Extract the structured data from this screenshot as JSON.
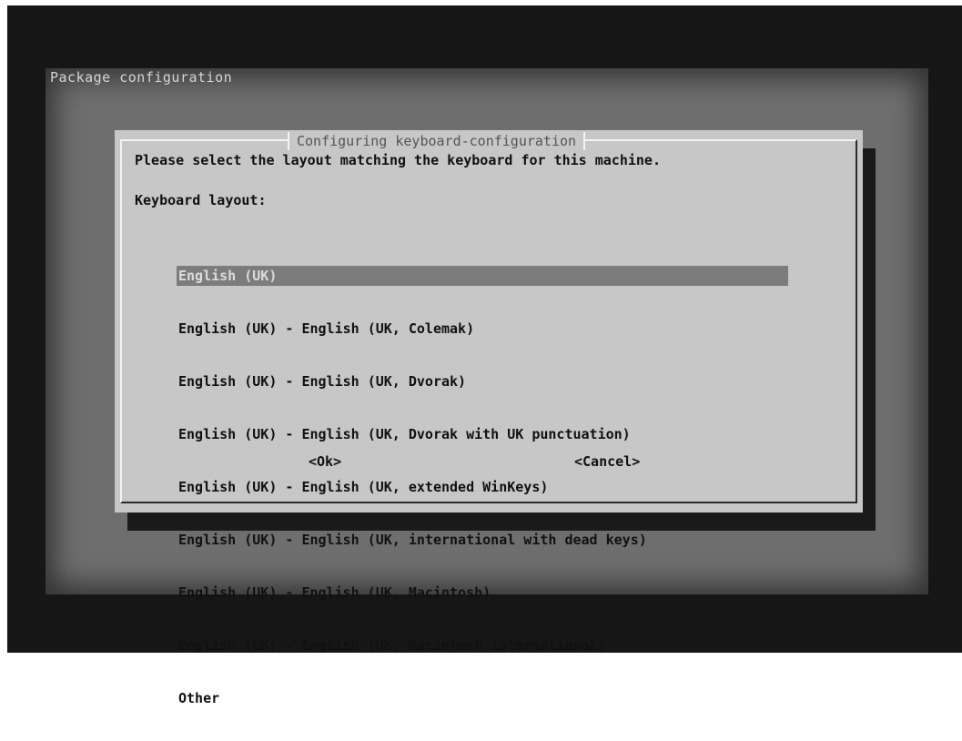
{
  "screen": {
    "title": "Package configuration"
  },
  "dialog": {
    "title": "Configuring keyboard-configuration",
    "prompt": "Please select the layout matching the keyboard for this machine.",
    "list_label": "Keyboard layout:",
    "items": [
      {
        "label": "English (UK)",
        "selected": true
      },
      {
        "label": "English (UK) - English (UK, Colemak)",
        "selected": false
      },
      {
        "label": "English (UK) - English (UK, Dvorak)",
        "selected": false
      },
      {
        "label": "English (UK) - English (UK, Dvorak with UK punctuation)",
        "selected": false
      },
      {
        "label": "English (UK) - English (UK, extended WinKeys)",
        "selected": false
      },
      {
        "label": "English (UK) - English (UK, international with dead keys)",
        "selected": false
      },
      {
        "label": "English (UK) - English (UK, Macintosh)",
        "selected": false
      },
      {
        "label": "English (UK) - English (UK, Macintosh international)",
        "selected": false
      },
      {
        "label": "Other",
        "selected": false
      }
    ],
    "ok_label": "<Ok>",
    "cancel_label": "<Cancel>"
  },
  "colors": {
    "screen_background": "#6e6e6e",
    "dialog_background": "#c7c7c7",
    "selection_highlight": "#7c7c7c"
  }
}
